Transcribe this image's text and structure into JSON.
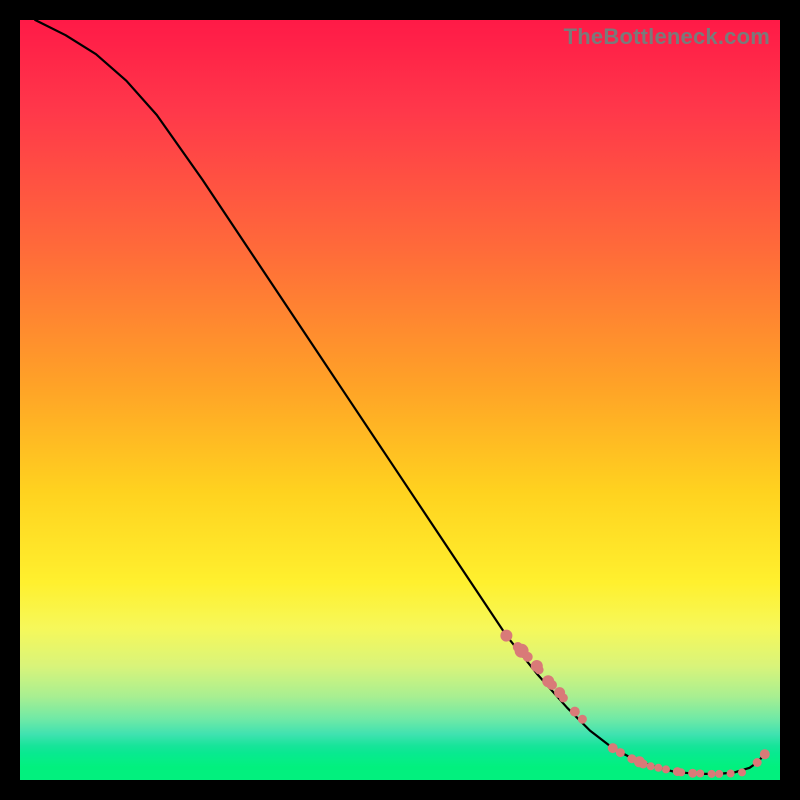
{
  "watermark": "TheBottleneck.com",
  "colors": {
    "dot": "#d97a78",
    "curve": "#000000",
    "gradient_top": "#ff1a47",
    "gradient_mid": "#ffd21f",
    "gradient_bottom": "#02f07e"
  },
  "chart_data": {
    "type": "line",
    "title": "",
    "xlabel": "",
    "ylabel": "",
    "xlim": [
      0,
      100
    ],
    "ylim": [
      0,
      100
    ],
    "note": "No axis ticks or numeric labels are rendered; x/y are normalized 0–100 estimates read from pixel position.",
    "series": [
      {
        "name": "curve",
        "x": [
          2,
          6,
          10,
          14,
          18,
          24,
          30,
          36,
          42,
          48,
          54,
          60,
          64,
          68,
          72,
          75,
          78,
          81,
          84,
          86,
          88,
          90,
          92,
          94,
          96,
          97,
          98
        ],
        "y": [
          100,
          98,
          95.5,
          92,
          87.5,
          79,
          70,
          61,
          52,
          43,
          34,
          25,
          19,
          14,
          9.5,
          6.5,
          4.2,
          2.6,
          1.6,
          1.1,
          0.9,
          0.8,
          0.8,
          1.0,
          1.6,
          2.3,
          3.4
        ]
      }
    ],
    "scatter_points": {
      "name": "dots",
      "note": "Coral dots clustered along the lower-right portion of the curve (valley and slight uptick).",
      "x": [
        64,
        65.5,
        66,
        66.8,
        68,
        68.3,
        69.5,
        70,
        71,
        71.5,
        73,
        74,
        78,
        79,
        80.5,
        81.5,
        82,
        83,
        84,
        85,
        86.5,
        87,
        88.5,
        89.5,
        91,
        92,
        93.5,
        95,
        97,
        98
      ],
      "y": [
        19,
        17.5,
        17,
        16.2,
        15,
        14.5,
        13,
        12.5,
        11.5,
        10.8,
        9,
        8,
        4.2,
        3.6,
        2.8,
        2.4,
        2.1,
        1.8,
        1.6,
        1.4,
        1.1,
        1.0,
        0.9,
        0.85,
        0.8,
        0.8,
        0.85,
        1.0,
        2.3,
        3.4
      ],
      "r": [
        6,
        5,
        7,
        5,
        6,
        4.5,
        6,
        5,
        5.5,
        4.5,
        5,
        4.5,
        5,
        4.5,
        4.5,
        5.5,
        4.5,
        4,
        4,
        4,
        4.5,
        4,
        4.5,
        4,
        4,
        4,
        4,
        4,
        4.5,
        5
      ]
    }
  }
}
